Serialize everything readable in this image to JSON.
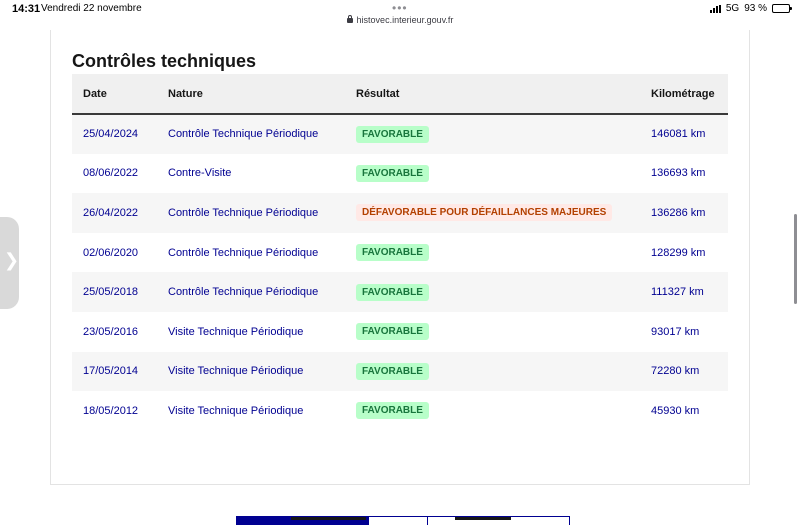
{
  "status_bar": {
    "time": "14:31",
    "date": "Vendredi 22 novembre",
    "url": "histovec.interieur.gouv.fr",
    "network": "5G",
    "battery": "93 %",
    "battery_level": 0.93
  },
  "section": {
    "title": "Contrôles techniques"
  },
  "table": {
    "headers": [
      "Date",
      "Nature",
      "Résultat",
      "Kilométrage"
    ],
    "rows": [
      {
        "date": "25/04/2024",
        "nature": "Contrôle Technique Périodique",
        "result": "FAVORABLE",
        "status": "ok",
        "km": "146081 km"
      },
      {
        "date": "08/06/2022",
        "nature": "Contre-Visite",
        "result": "FAVORABLE",
        "status": "ok",
        "km": "136693 km"
      },
      {
        "date": "26/04/2022",
        "nature": "Contrôle Technique Périodique",
        "result": "DÉFAVORABLE POUR DÉFAILLANCES MAJEURES",
        "status": "ko",
        "km": "136286 km"
      },
      {
        "date": "02/06/2020",
        "nature": "Contrôle Technique Périodique",
        "result": "FAVORABLE",
        "status": "ok",
        "km": "128299 km"
      },
      {
        "date": "25/05/2018",
        "nature": "Contrôle Technique Périodique",
        "result": "FAVORABLE",
        "status": "ok",
        "km": "111327 km"
      },
      {
        "date": "23/05/2016",
        "nature": "Visite Technique Périodique",
        "result": "FAVORABLE",
        "status": "ok",
        "km": "93017 km"
      },
      {
        "date": "17/05/2014",
        "nature": "Visite Technique Périodique",
        "result": "FAVORABLE",
        "status": "ok",
        "km": "72280 km"
      },
      {
        "date": "18/05/2012",
        "nature": "Visite Technique Périodique",
        "result": "FAVORABLE",
        "status": "ok",
        "km": "45930 km"
      }
    ]
  },
  "colors": {
    "link_blue": "#000091",
    "ok_bg": "#b8fec9",
    "ok_text": "#18753c",
    "ko_bg": "#ffe9e6",
    "ko_text": "#b34000"
  },
  "icons": {
    "lock": "lock-icon",
    "signal": "signal-icon",
    "battery": "battery-icon",
    "more": "more-dots-icon",
    "side_handle": "chevron-right-icon"
  }
}
